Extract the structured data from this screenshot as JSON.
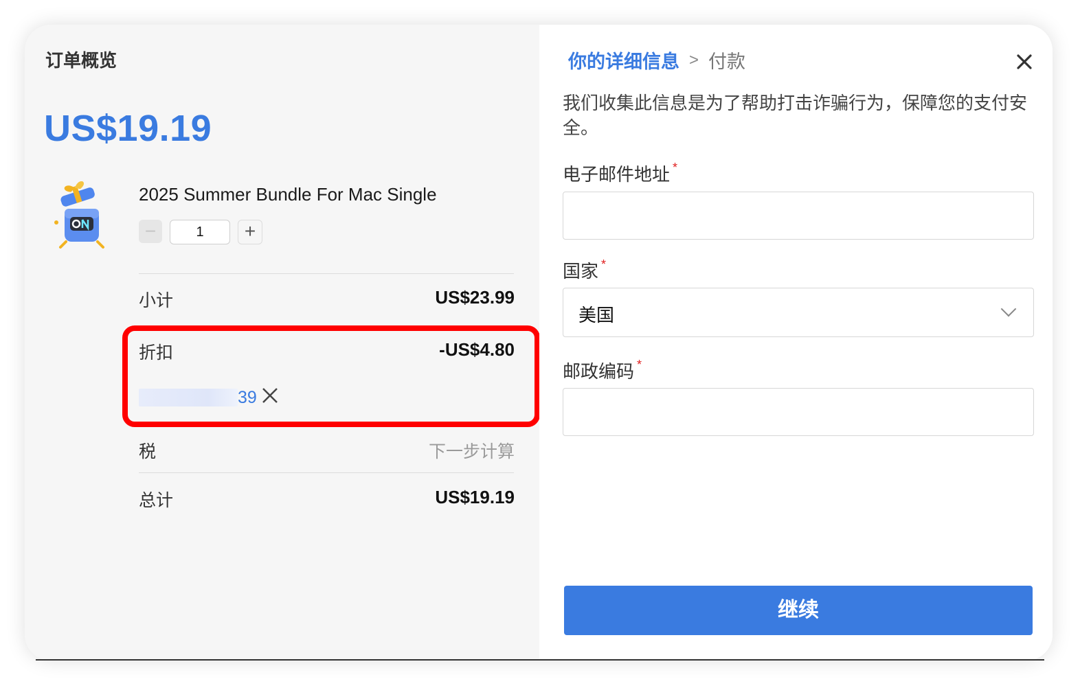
{
  "order_summary": {
    "title": "订单概览",
    "total_price": "US$19.19",
    "product": {
      "name": "2025 Summer Bundle For Mac Single",
      "quantity": "1",
      "minus_icon": "minus-icon",
      "plus_icon": "plus-icon",
      "image_icon": "gift-box-mascot-icon"
    },
    "subtotal": {
      "label": "小计",
      "value": "US$23.99"
    },
    "discount": {
      "label": "折扣",
      "value": "-US$4.80",
      "coupon_code_visible_tail": "39",
      "remove_icon": "close-icon"
    },
    "tax": {
      "label": "税",
      "value": "下一步计算"
    },
    "total": {
      "label": "总计",
      "value": "US$19.19"
    }
  },
  "details": {
    "breadcrumb": {
      "active": "你的详细信息",
      "separator": ">",
      "next": "付款"
    },
    "close_icon": "close-icon",
    "info_text": "我们收集此信息是为了帮助打击诈骗行为，保障您的支付安全。",
    "email": {
      "label": "电子邮件地址",
      "required_mark": "*",
      "value": ""
    },
    "country": {
      "label": "国家",
      "required_mark": "*",
      "selected": "美国",
      "chevron_icon": "chevron-down-icon"
    },
    "postal_code": {
      "label": "邮政编码",
      "required_mark": "*",
      "value": ""
    },
    "continue_label": "继续"
  },
  "colors": {
    "accent": "#3a7be0",
    "highlight": "#ff0000",
    "required": "#e02020"
  }
}
